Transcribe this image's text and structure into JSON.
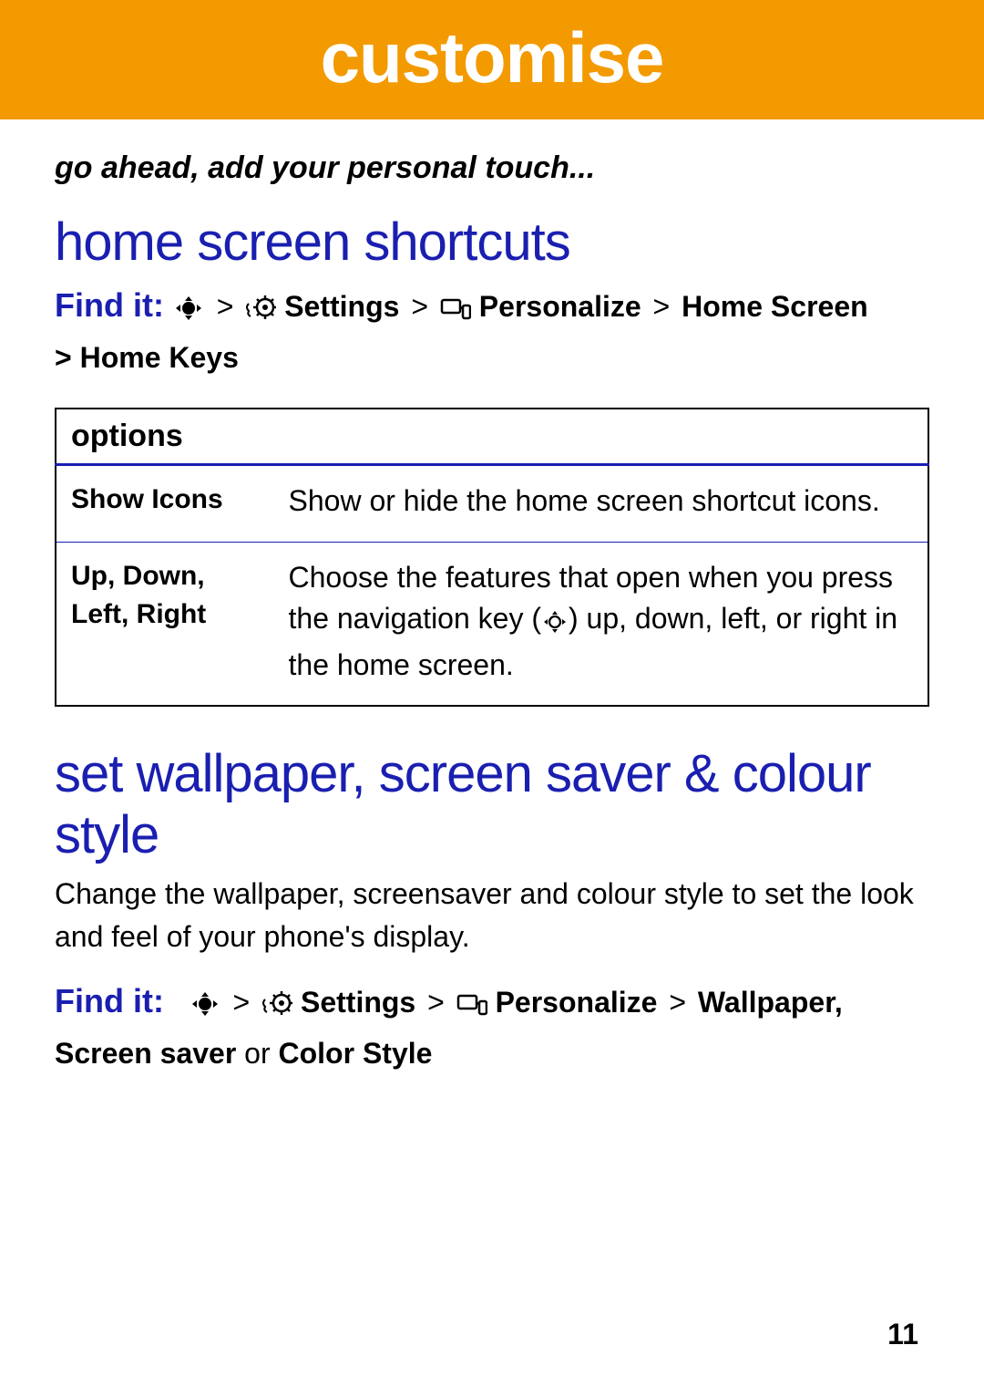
{
  "banner": {
    "title": "customise"
  },
  "tagline": "go ahead, add your personal touch...",
  "section1": {
    "heading": "home screen shortcuts",
    "findit_label": "Find it:",
    "chev": ">",
    "settings": "Settings",
    "personalize": "Personalize",
    "tail1": "Home Screen",
    "tail2": "> Home Keys"
  },
  "options_table": {
    "header": "options",
    "rows": [
      {
        "name": "Show Icons",
        "desc": "Show or hide the home screen shortcut icons."
      },
      {
        "name": "Up, Down, Left, Right",
        "desc_pre": "Choose the features that open when you press the navigation key (",
        "desc_post": ") up, down, left, or right in the home screen."
      }
    ]
  },
  "section2": {
    "heading": "set wallpaper, screen saver & colour style",
    "para": "Change the wallpaper, screensaver and colour style to set the look and feel of your phone's display.",
    "findit_label": "Find it:",
    "chev": ">",
    "settings": "Settings",
    "personalize": "Personalize",
    "tail_a": "Wallpaper",
    "tail_b": ", Screen saver",
    "or": " or ",
    "tail_c": "Color Style"
  },
  "page_number": "11"
}
